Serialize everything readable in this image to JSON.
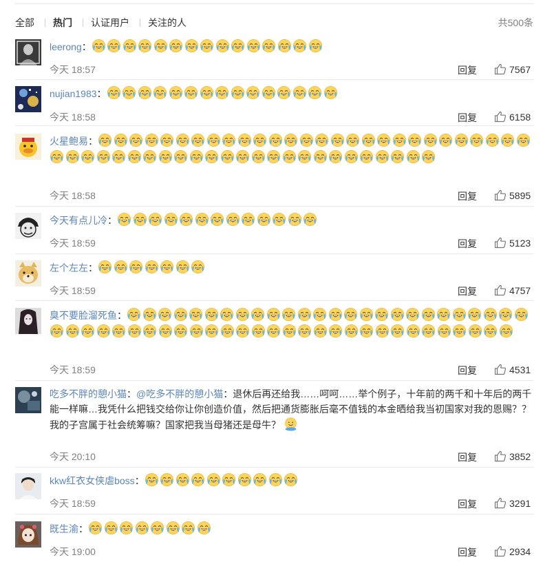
{
  "tabs": [
    {
      "label": "全部"
    },
    {
      "label": "热门"
    },
    {
      "label": "认证用户"
    },
    {
      "label": "关注的人"
    }
  ],
  "active_tab": "热门",
  "total_count": "共500条",
  "reply_label": "回复",
  "emoji_name": "crying-laughing-emoji",
  "comments": [
    {
      "user": "leerong",
      "sep": "：",
      "text": "",
      "emoji_count": 15,
      "time": "今天 18:57",
      "likes": "7567",
      "avatar": "person-portrait-avatar"
    },
    {
      "user": "nujian1983",
      "sep": "：",
      "text": "",
      "emoji_count": 15,
      "time": "今天 18:58",
      "likes": "6158",
      "avatar": "anime-art-avatar"
    },
    {
      "user": "火星鲍易",
      "sep": "：",
      "text": "",
      "emoji_count": 53,
      "time": "今天 18:58",
      "likes": "5895",
      "avatar": "yellow-duck-avatar"
    },
    {
      "user": "今天有点儿冷",
      "sep": "：",
      "text": "",
      "emoji_count": 13,
      "time": "今天 18:59",
      "likes": "5123",
      "avatar": "anime-pirate-avatar"
    },
    {
      "user": "左个左左",
      "sep": "：",
      "text": "",
      "emoji_count": 7,
      "time": "今天 18:59",
      "likes": "4757",
      "avatar": "shiba-dog-avatar"
    },
    {
      "user": "臭不要脸溜死鱼",
      "sep": "：",
      "text": "",
      "emoji_count": 56,
      "time": "今天 18:59",
      "likes": "4531",
      "avatar": "dark-hair-avatar"
    },
    {
      "user": "吃多不胖的憩小猫",
      "sep": "：",
      "mention": "@吃多不胖的憩小猫",
      "text": "：退休后再还给我……呵呵……举个例子，十年前的两千和十年后的两千能一样嘛…我凭什么把钱交给你让你创造价值，然后把通货膨胀后毫不值钱的本金晒给我当初国家对我的恩赐？？我的子宫属于社会统筹嘛？国家把我当母猪还是母牛？",
      "emoji_count": 0,
      "end_emoji": "hugging-emoji",
      "time": "今天 20:10",
      "likes": "3852",
      "avatar": "blurred-photo-avatar"
    },
    {
      "user": "kkw红衣女侠虐boss",
      "sep": "：",
      "text": "",
      "emoji_count": 10,
      "time": "今天 18:59",
      "likes": "3291",
      "avatar": "young-man-avatar"
    },
    {
      "user": "既生渝",
      "sep": "：",
      "text": "",
      "emoji_count": 8,
      "time": "今天 19:00",
      "likes": "2934",
      "avatar": "anime-girl-avatar"
    }
  ]
}
